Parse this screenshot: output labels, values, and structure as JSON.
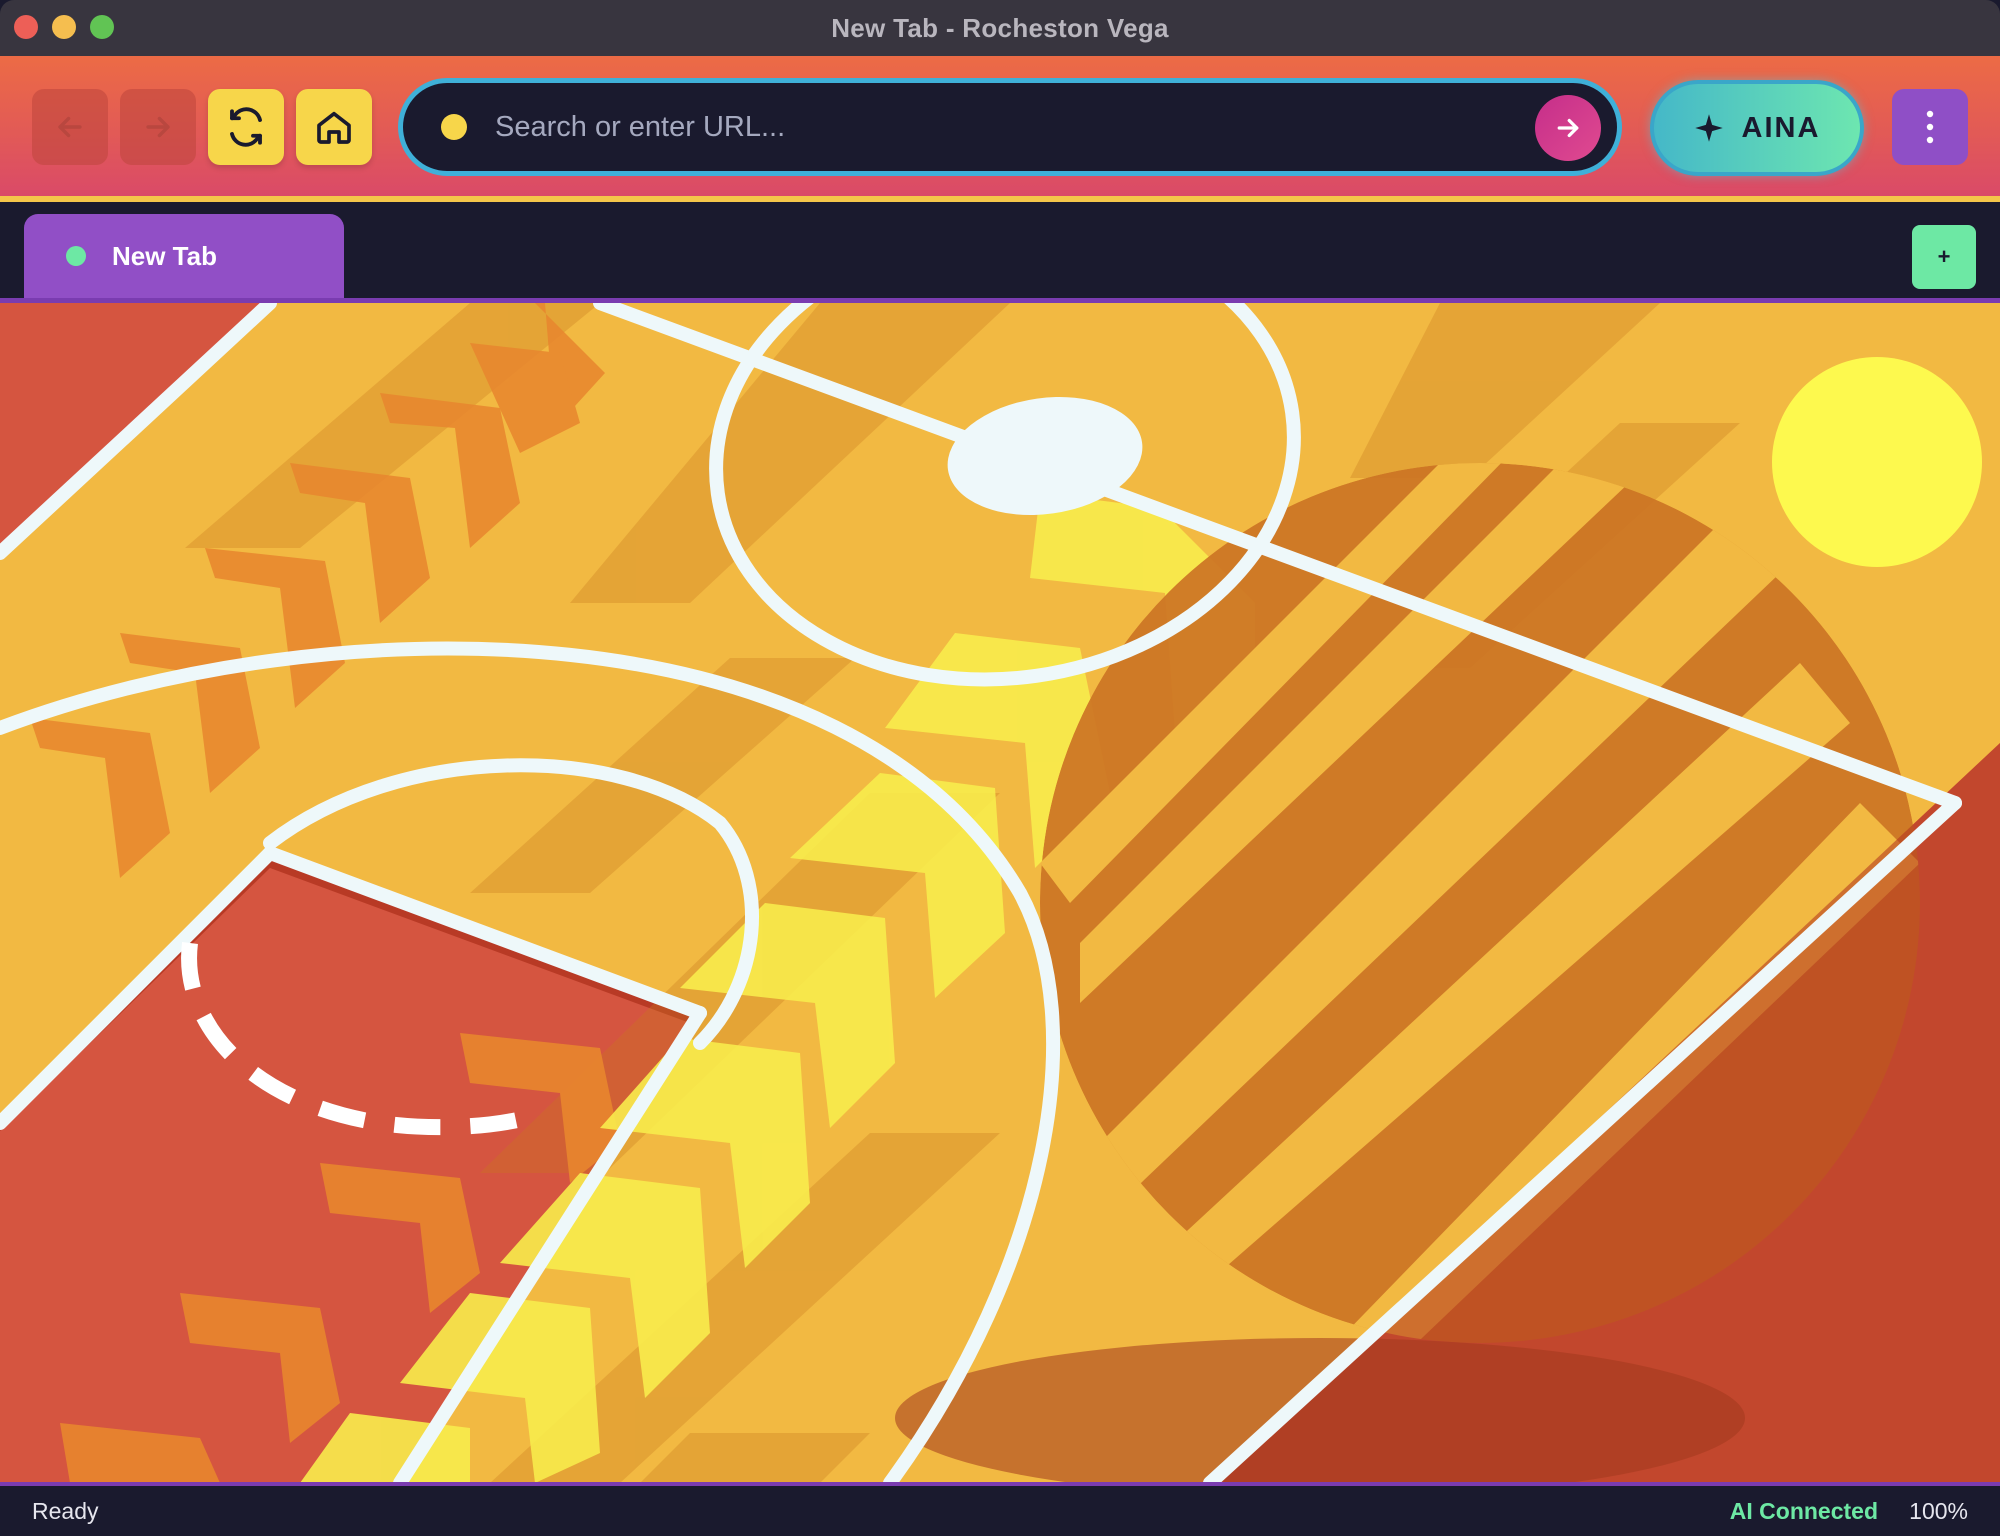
{
  "window": {
    "title": "New Tab - Rocheston Vega"
  },
  "toolbar": {
    "back_icon": "arrow-left-icon",
    "forward_icon": "arrow-right-icon",
    "reload_icon": "reload-icon",
    "home_icon": "home-icon",
    "back_enabled": false,
    "forward_enabled": false,
    "search": {
      "placeholder": "Search or enter URL...",
      "value": ""
    },
    "go_icon": "arrow-right-icon",
    "ai_button_label": "AINA",
    "ai_icon": "sparkle-icon",
    "menu_icon": "vertical-dots-icon"
  },
  "tabs": [
    {
      "label": "New Tab",
      "active": true,
      "status_color": "#6de8a4"
    }
  ],
  "new_tab_label": "+",
  "content": {
    "illustration": "basketball-court-illustration"
  },
  "status": {
    "left": "Ready",
    "ai": "AI Connected",
    "zoom": "100%"
  },
  "colors": {
    "toolbar_gradient": [
      "#ec6b45",
      "#da4a68"
    ],
    "accent_yellow": "#f7d64a",
    "accent_purple": "#914fc6",
    "accent_green": "#6de8a4",
    "url_border": "#3fb0d8",
    "dark": "#1a1a2e"
  }
}
